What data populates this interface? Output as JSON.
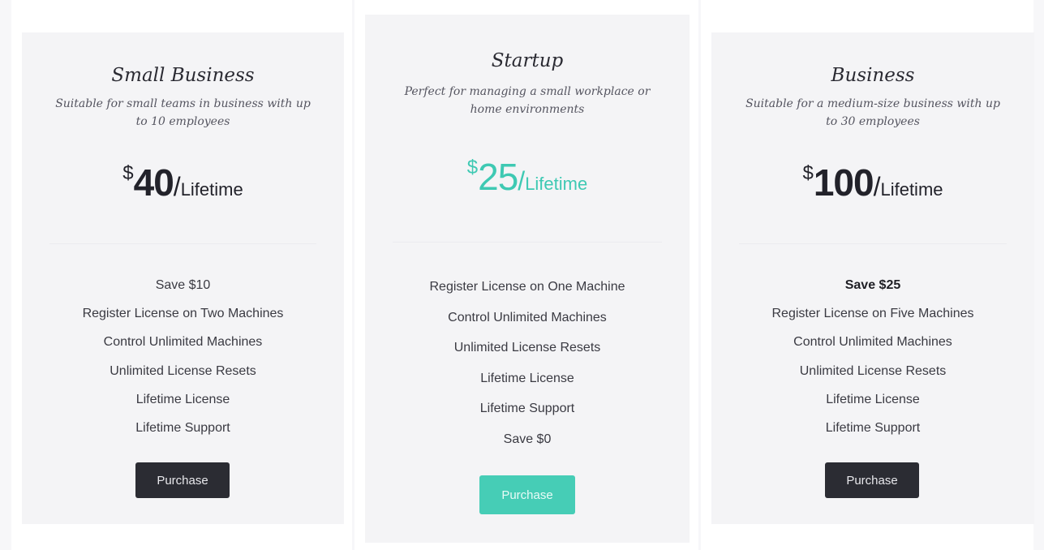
{
  "colors": {
    "accent": "#46cdb6",
    "dark_button": "#2b2c33",
    "card_background": "#f4f4f6"
  },
  "plans": [
    {
      "title": "Small Business",
      "description": "Suitable for small teams in business with up to 10 employees",
      "currency": "$",
      "amount": "40",
      "slash": "/",
      "period": "Lifetime",
      "features": [
        "Save $10",
        "Register License on Two Machines",
        "Control Unlimited Machines",
        "Unlimited License Resets",
        "Lifetime License",
        "Lifetime Support"
      ],
      "button_label": "Purchase"
    },
    {
      "title": "Startup",
      "description": "Perfect for managing a small workplace or home environments",
      "currency": "$",
      "amount": "25",
      "slash": "/",
      "period": "Lifetime",
      "features": [
        "Register License on One Machine",
        "Control Unlimited Machines",
        "Unlimited License Resets",
        "Lifetime License",
        "Lifetime Support",
        "Save $0"
      ],
      "button_label": "Purchase"
    },
    {
      "title": "Business",
      "description": "Suitable for a medium-size business with up to 30 employees",
      "currency": "$",
      "amount": "100",
      "slash": "/",
      "period": "Lifetime",
      "features": [
        "Save $25",
        "Register License on Five Machines",
        "Control Unlimited Machines",
        "Unlimited License Resets",
        "Lifetime License",
        "Lifetime Support"
      ],
      "button_label": "Purchase"
    }
  ]
}
